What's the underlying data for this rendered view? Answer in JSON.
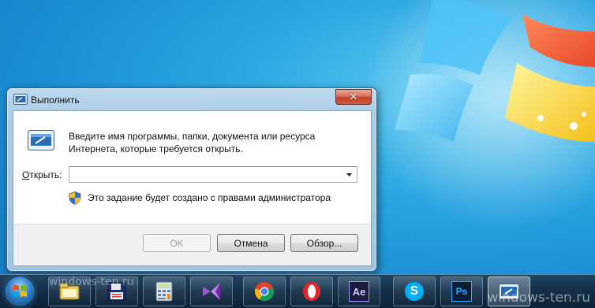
{
  "dialog": {
    "title": "Выполнить",
    "close_icon": "close-icon",
    "description": "Введите имя программы, папки, документа или ресурса Интернета, которые требуется открыть.",
    "open_label_accel": "О",
    "open_label_rest": "ткрыть:",
    "open_value": "",
    "admin_note": "Это задание будет создано с правами администратора",
    "ok_label": "OK",
    "cancel_label": "Отмена",
    "browse_label": "Обзор..."
  },
  "taskbar": {
    "items": [
      {
        "icon": "windows-explorer-icon"
      },
      {
        "icon": "floppy-save-icon"
      },
      {
        "icon": "calculator-icon"
      },
      {
        "icon": "visual-studio-icon"
      },
      {
        "icon": "chrome-icon"
      },
      {
        "icon": "opera-icon"
      },
      {
        "icon": "after-effects-icon",
        "text": "Ae"
      },
      {
        "icon": "skype-icon",
        "text": "S"
      },
      {
        "icon": "photoshop-icon",
        "text": "Ps"
      },
      {
        "icon": "run-dialog-icon"
      }
    ]
  },
  "watermarks": {
    "left": "windows-ten.ru",
    "right": "windows-ten.ru"
  }
}
